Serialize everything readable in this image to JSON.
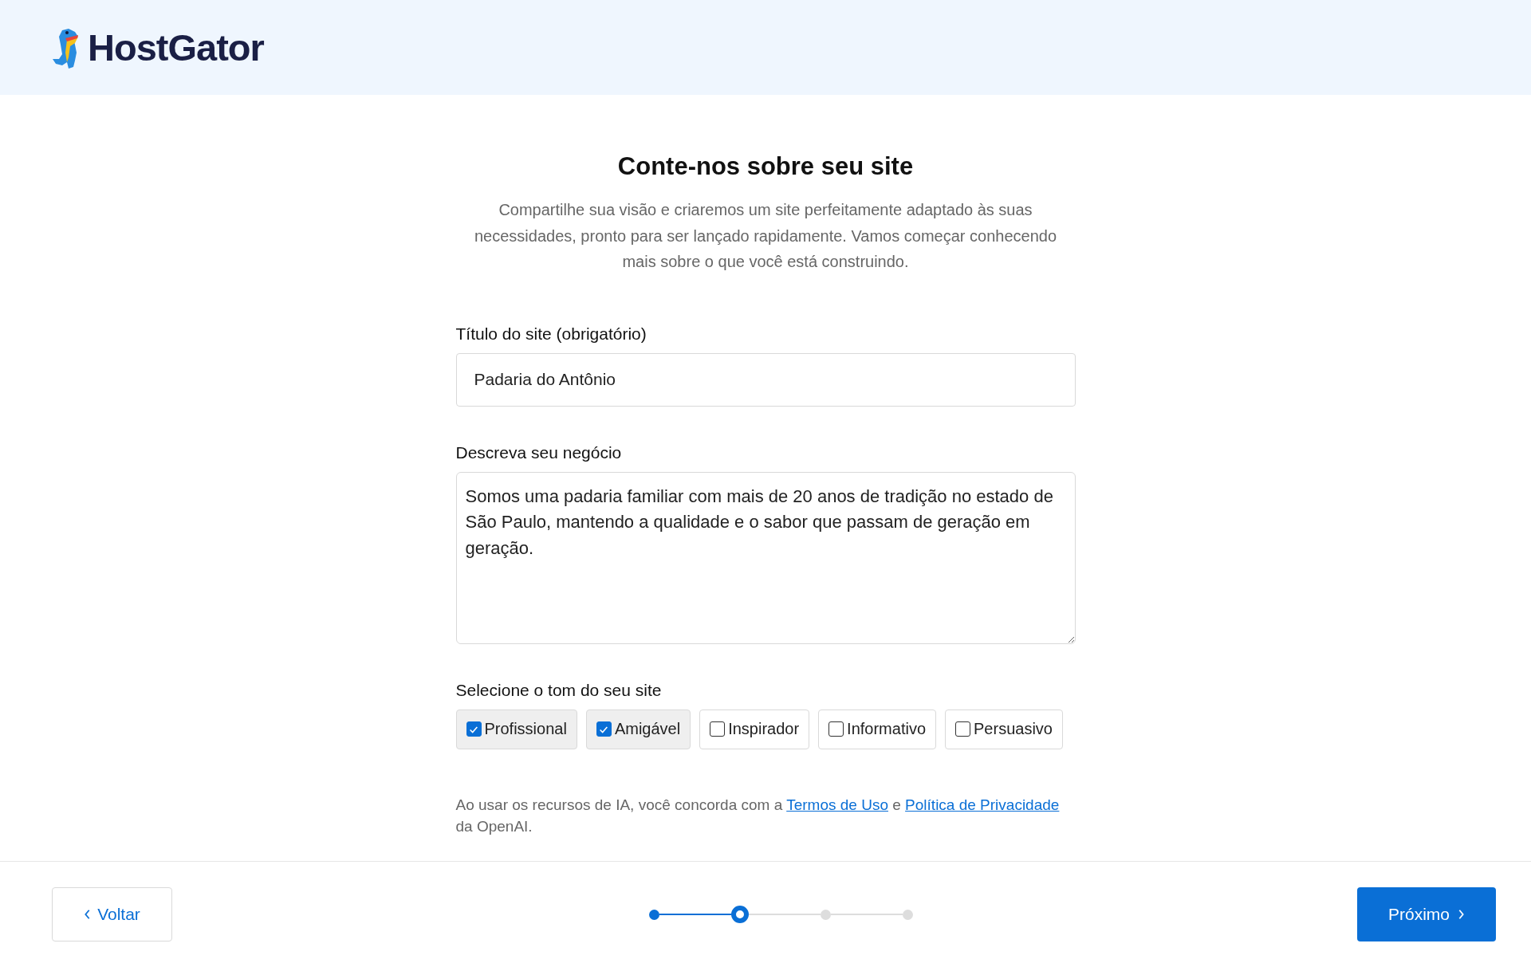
{
  "header": {
    "logo_text": "HostGator"
  },
  "heading": "Conte-nos sobre seu site",
  "intro": "Compartilhe sua visão e criaremos um site perfeitamente adaptado às suas necessidades, pronto para ser lançado rapidamente. Vamos começar conhecendo mais sobre o que você está construindo.",
  "title_field": {
    "label": "Título do site (obrigatório)",
    "value": "Padaria do Antônio"
  },
  "description_field": {
    "label": "Descreva seu negócio",
    "value": "Somos uma padaria familiar com mais de 20 anos de tradição no estado de São Paulo, mantendo a qualidade e o sabor que passam de geração em geração."
  },
  "tone": {
    "label": "Selecione o tom do seu site",
    "options": [
      {
        "label": "Profissional",
        "checked": true
      },
      {
        "label": "Amigável",
        "checked": true
      },
      {
        "label": "Inspirador",
        "checked": false
      },
      {
        "label": "Informativo",
        "checked": false
      },
      {
        "label": "Persuasivo",
        "checked": false
      }
    ]
  },
  "disclaimer": {
    "text_1": "Ao usar os recursos de IA, você concorda com a",
    "link_1": "Termos de Uso",
    "text_2": "e",
    "link_2": "Política de Privacidade",
    "text_3": "da OpenAI."
  },
  "footer": {
    "back_button": "Voltar",
    "next_button": "Próximo",
    "steps": [
      {
        "completed": true,
        "selected": false
      },
      {
        "completed": false,
        "selected": true
      },
      {
        "completed": false,
        "selected": false
      },
      {
        "completed": false,
        "selected": false
      }
    ]
  }
}
